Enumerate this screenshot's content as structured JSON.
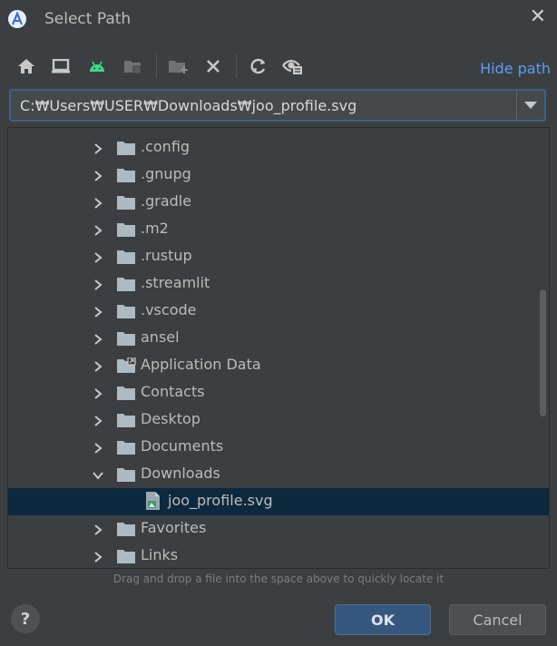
{
  "dialog": {
    "title": "Select Path"
  },
  "toolbar": {
    "icons": [
      "home-icon",
      "desktop-icon",
      "android-icon",
      "module-icon",
      "new-folder-icon",
      "delete-icon",
      "refresh-icon",
      "show-hidden-icon"
    ],
    "hide_path_label": "Hide path"
  },
  "path": {
    "value": "C:₩Users₩USER₩Downloads₩joo_profile.svg"
  },
  "tree": {
    "items": [
      {
        "label": ".config",
        "expanded": false
      },
      {
        "label": ".gnupg",
        "expanded": false
      },
      {
        "label": ".gradle",
        "expanded": false
      },
      {
        "label": ".m2",
        "expanded": false
      },
      {
        "label": ".rustup",
        "expanded": false
      },
      {
        "label": ".streamlit",
        "expanded": false
      },
      {
        "label": ".vscode",
        "expanded": false
      },
      {
        "label": "ansel",
        "expanded": false
      },
      {
        "label": "Application Data",
        "expanded": false,
        "link": true
      },
      {
        "label": "Contacts",
        "expanded": false
      },
      {
        "label": "Desktop",
        "expanded": false
      },
      {
        "label": "Documents",
        "expanded": false
      },
      {
        "label": "Downloads",
        "expanded": true
      },
      {
        "label": "joo_profile.svg",
        "file": true,
        "selected": true
      },
      {
        "label": "Favorites",
        "expanded": false
      },
      {
        "label": "Links",
        "expanded": false
      }
    ]
  },
  "hint": "Drag and drop a file into the space above to quickly locate it",
  "buttons": {
    "help": "?",
    "ok": "OK",
    "cancel": "Cancel"
  },
  "colors": {
    "accent_link": "#589df6",
    "selection": "#0d293e",
    "ok_button": "#365880",
    "android_green": "#3ddc84"
  }
}
